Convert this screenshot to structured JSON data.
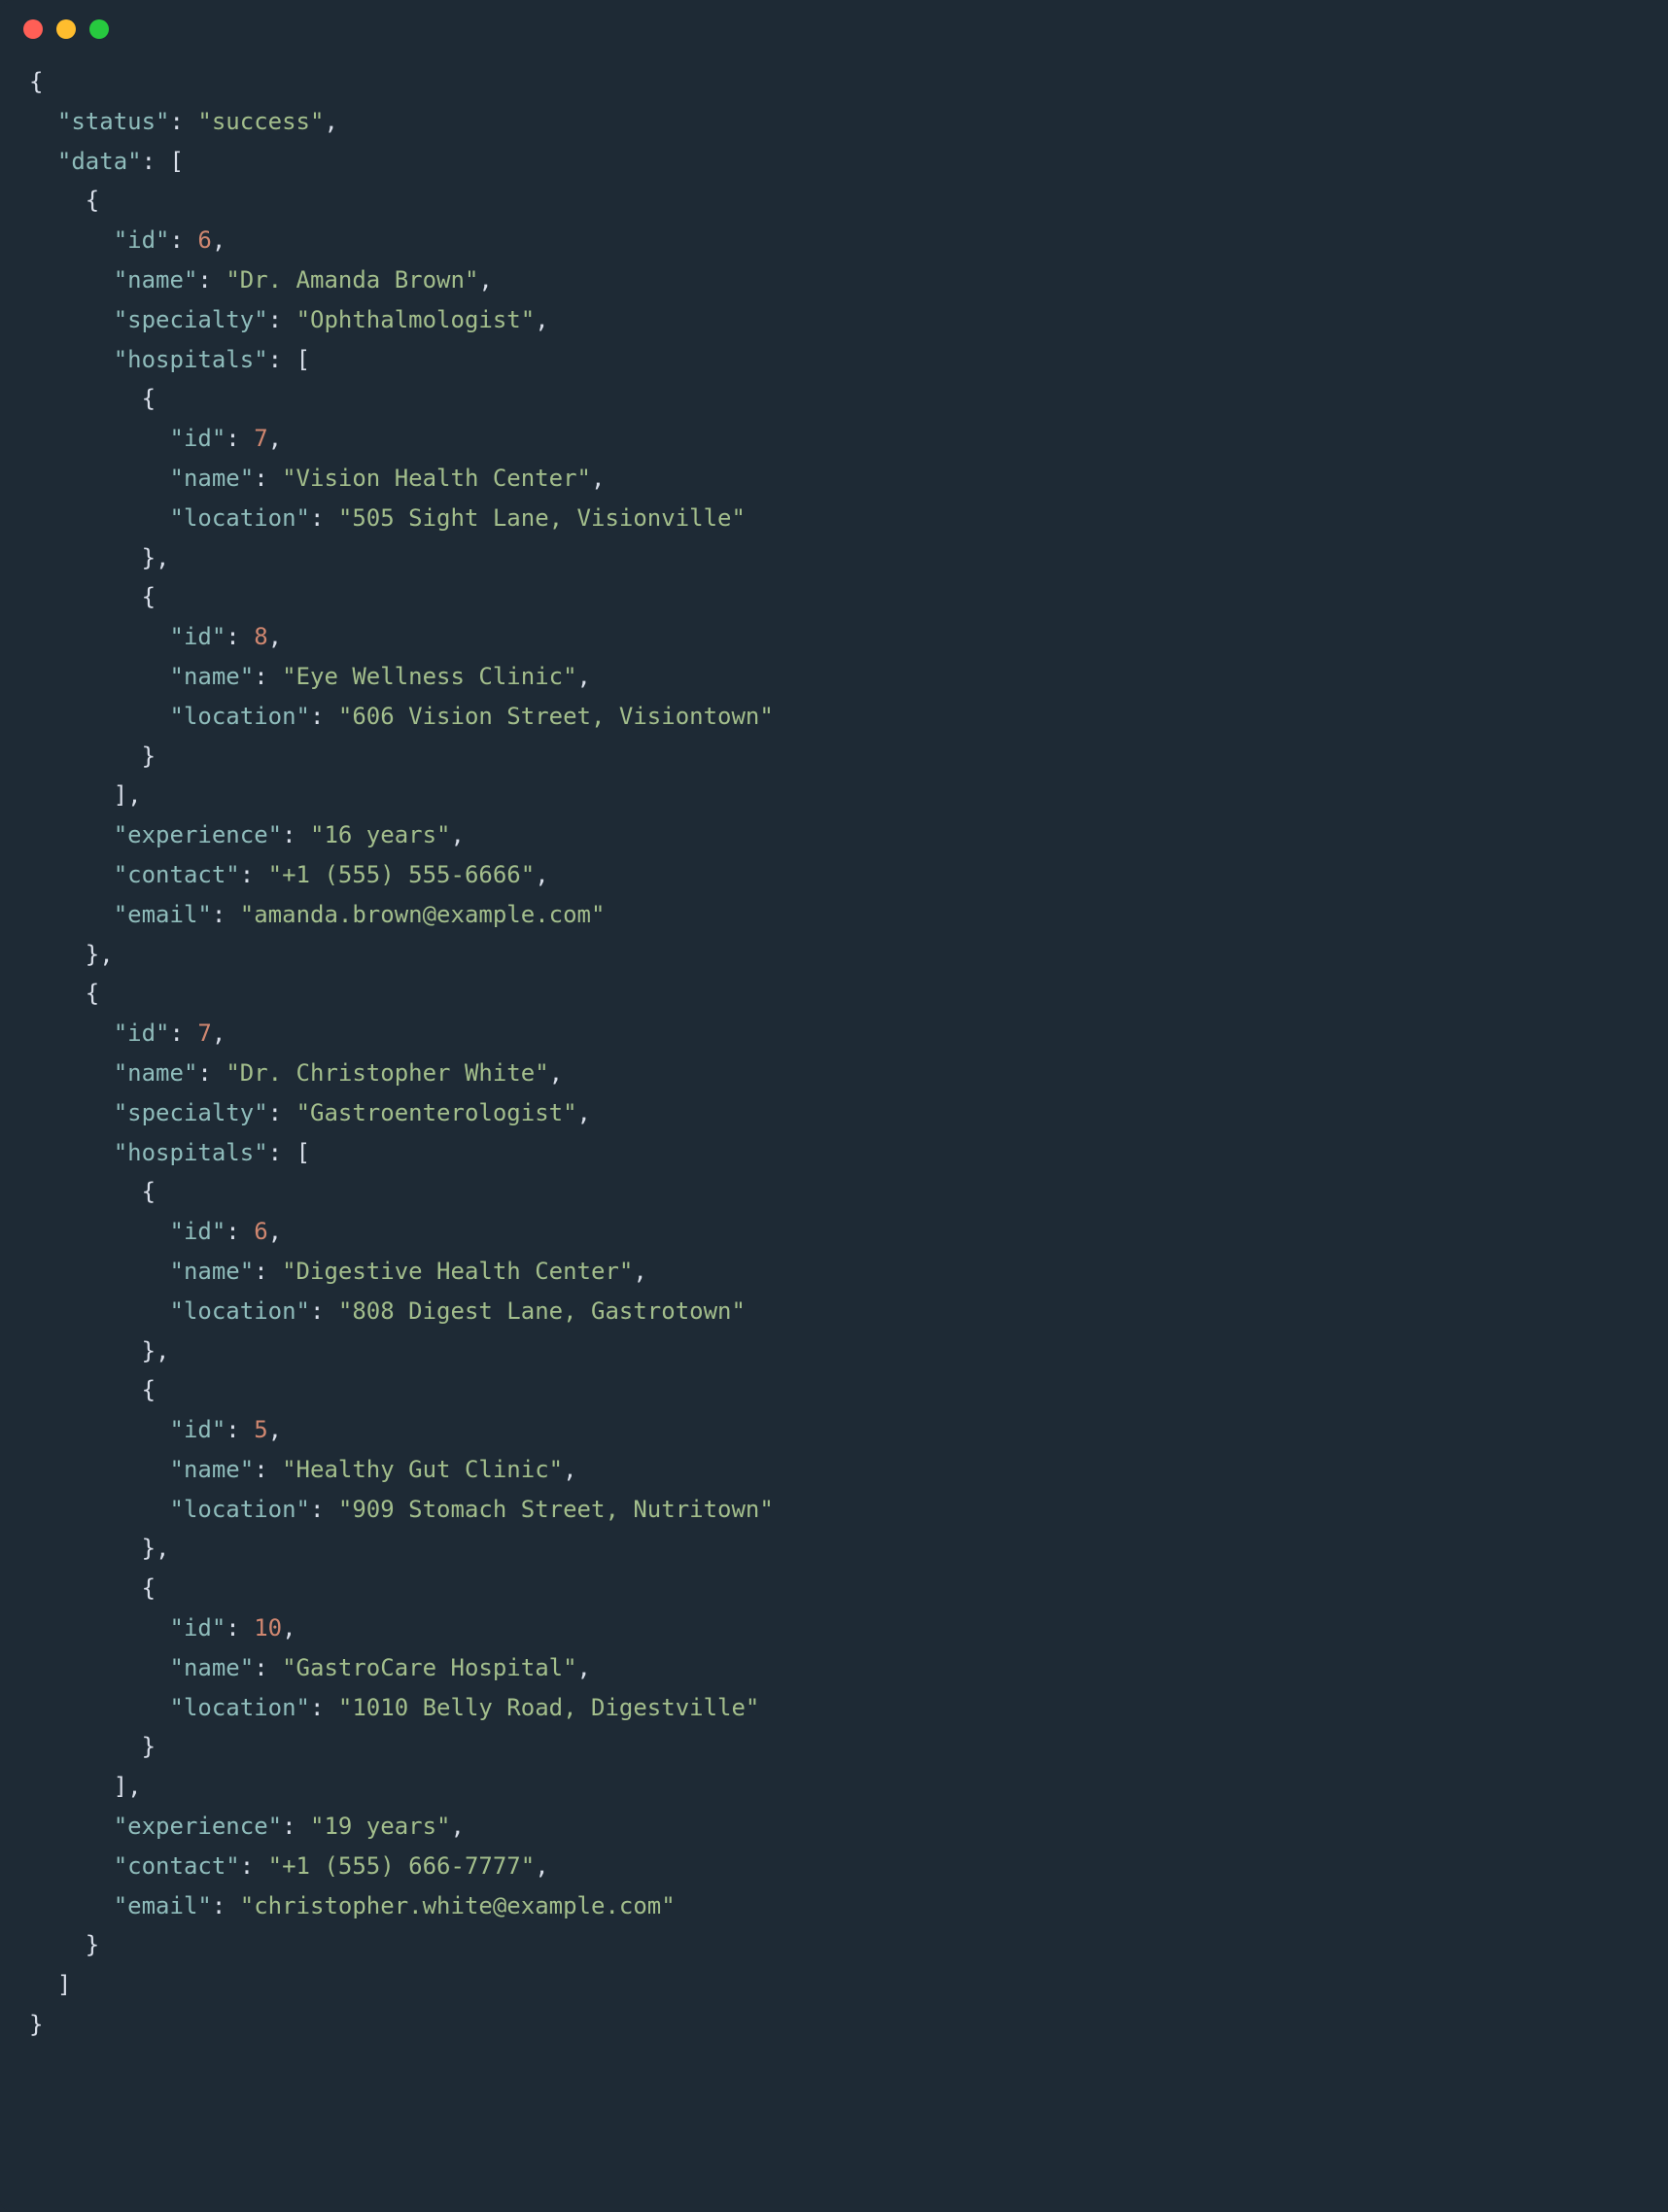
{
  "json": {
    "status": "success",
    "data": [
      {
        "id": 6,
        "name": "Dr. Amanda Brown",
        "specialty": "Ophthalmologist",
        "hospitals": [
          {
            "id": 7,
            "name": "Vision Health Center",
            "location": "505 Sight Lane, Visionville"
          },
          {
            "id": 8,
            "name": "Eye Wellness Clinic",
            "location": "606 Vision Street, Visiontown"
          }
        ],
        "experience": "16 years",
        "contact": "+1 (555) 555-6666",
        "email": "amanda.brown@example.com"
      },
      {
        "id": 7,
        "name": "Dr. Christopher White",
        "specialty": "Gastroenterologist",
        "hospitals": [
          {
            "id": 6,
            "name": "Digestive Health Center",
            "location": "808 Digest Lane, Gastrotown"
          },
          {
            "id": 5,
            "name": "Healthy Gut Clinic",
            "location": "909 Stomach Street, Nutritown"
          },
          {
            "id": 10,
            "name": "GastroCare Hospital",
            "location": "1010 Belly Road, Digestville"
          }
        ],
        "experience": "19 years",
        "contact": "+1 (555) 666-7777",
        "email": "christopher.white@example.com"
      }
    ]
  }
}
